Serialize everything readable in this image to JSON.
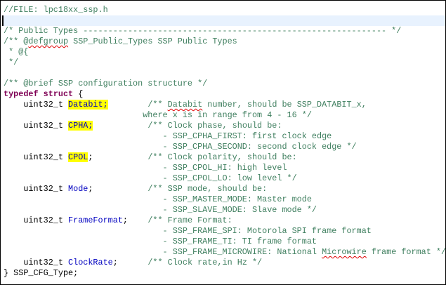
{
  "editor": {
    "lines": [
      [
        {
          "t": "//FILE: lpc18xx_ssp.h",
          "c": "cm"
        }
      ],
      [],
      [
        {
          "t": "/* Public Types ------------------------------------------------------------- */",
          "c": "cm"
        }
      ],
      [
        {
          "t": "/** @",
          "c": "cm"
        },
        {
          "t": "defgroup",
          "c": "cm sq"
        },
        {
          "t": " SSP_Public_Types SSP Public Types",
          "c": "cm"
        }
      ],
      [
        {
          "t": " * @{",
          "c": "cm"
        }
      ],
      [
        {
          "t": " */",
          "c": "cm"
        }
      ],
      [],
      [
        {
          "t": "/** @brief SSP configuration structure */",
          "c": "cm"
        }
      ],
      [
        {
          "t": "typedef",
          "c": "kw"
        },
        {
          "t": " ",
          "c": ""
        },
        {
          "t": "struct",
          "c": "kw"
        },
        {
          "t": " {",
          "c": ""
        }
      ],
      [
        {
          "t": "    uint32_t ",
          "c": ""
        },
        {
          "t": "Databit;",
          "c": "fld hl"
        },
        {
          "t": "        ",
          "c": ""
        },
        {
          "t": "/** ",
          "c": "cm"
        },
        {
          "t": "Databit",
          "c": "cm sq"
        },
        {
          "t": " number, should be SSP_DATABIT_x,",
          "c": "cm"
        }
      ],
      [
        {
          "t": "                            where x is in range from 4 - 16 */",
          "c": "cm"
        }
      ],
      [
        {
          "t": "    uint32_t ",
          "c": ""
        },
        {
          "t": "CPHA;",
          "c": "fld hl"
        },
        {
          "t": "           ",
          "c": ""
        },
        {
          "t": "/** Clock phase, should be:",
          "c": "cm"
        }
      ],
      [
        {
          "t": "                                - SSP_CPHA_FIRST: first clock edge",
          "c": "cm"
        }
      ],
      [
        {
          "t": "                                - SSP_CPHA_SECOND: second clock edge */",
          "c": "cm"
        }
      ],
      [
        {
          "t": "    uint32_t ",
          "c": ""
        },
        {
          "t": "CPOL",
          "c": "fld hl"
        },
        {
          "t": ";",
          "c": ""
        },
        {
          "t": "           ",
          "c": ""
        },
        {
          "t": "/** Clock polarity, should be:",
          "c": "cm"
        }
      ],
      [
        {
          "t": "                                - SSP_CPOL_HI: high level",
          "c": "cm"
        }
      ],
      [
        {
          "t": "                                - SSP_CPOL_LO: low level */",
          "c": "cm"
        }
      ],
      [
        {
          "t": "    uint32_t ",
          "c": ""
        },
        {
          "t": "Mode",
          "c": "fld"
        },
        {
          "t": ";           ",
          "c": ""
        },
        {
          "t": "/** SSP mode, should be:",
          "c": "cm"
        }
      ],
      [
        {
          "t": "                                - SSP_MASTER_MODE: Master mode",
          "c": "cm"
        }
      ],
      [
        {
          "t": "                                - SSP_SLAVE_MODE: Slave mode */",
          "c": "cm"
        }
      ],
      [
        {
          "t": "    uint32_t ",
          "c": ""
        },
        {
          "t": "FrameFormat",
          "c": "fld"
        },
        {
          "t": ";    ",
          "c": ""
        },
        {
          "t": "/** Frame Format:",
          "c": "cm"
        }
      ],
      [
        {
          "t": "                                - SSP_FRAME_SPI: Motorola SPI frame format",
          "c": "cm"
        }
      ],
      [
        {
          "t": "                                - SSP_FRAME_TI: TI frame format",
          "c": "cm"
        }
      ],
      [
        {
          "t": "                                - SSP_FRAME_MICROWIRE: National ",
          "c": "cm"
        },
        {
          "t": "Microwire",
          "c": "cm sq"
        },
        {
          "t": " frame format */",
          "c": "cm"
        }
      ],
      [
        {
          "t": "    uint32_t ",
          "c": ""
        },
        {
          "t": "ClockRate",
          "c": "fld"
        },
        {
          "t": ";      ",
          "c": ""
        },
        {
          "t": "/** Clock rate,in Hz */",
          "c": "cm"
        }
      ],
      [
        {
          "t": "} SSP_CFG_Type;",
          "c": ""
        }
      ]
    ]
  }
}
